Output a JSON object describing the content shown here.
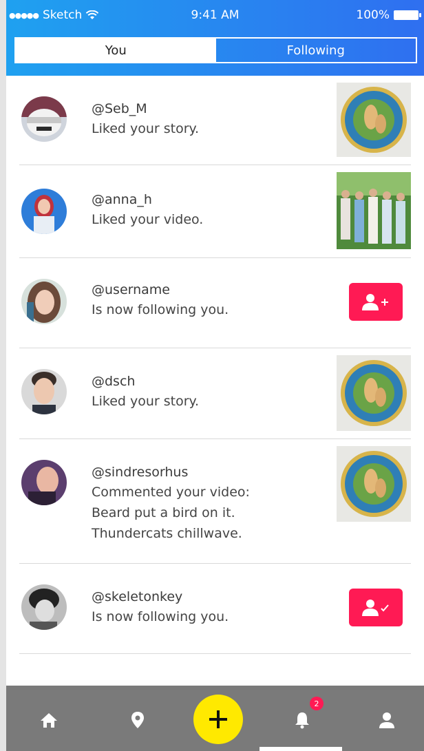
{
  "status": {
    "carrier": "Sketch",
    "time": "9:41 AM",
    "battery": "100%"
  },
  "tabs": {
    "you": "You",
    "following": "Following",
    "active": "you"
  },
  "notifications": [
    {
      "username": "@Seb_M",
      "message": "Liked your story.",
      "action": "thumbnail",
      "thumb": "plate"
    },
    {
      "username": "@anna_h",
      "message": "Liked your video.",
      "action": "thumbnail",
      "thumb": "group-photo"
    },
    {
      "username": "@username",
      "message": "Is now following you.",
      "action": "follow-back"
    },
    {
      "username": "@dsch",
      "message": "Liked your story.",
      "action": "thumbnail",
      "thumb": "plate"
    },
    {
      "username": "@sindresorhus",
      "message": "Commented your video:",
      "comment_line1": "Beard put a bird on it.",
      "comment_line2": "Thundercats chillwave.",
      "action": "thumbnail",
      "thumb": "plate"
    },
    {
      "username": "@skeletonkey",
      "message": "Is now following you.",
      "action": "following"
    }
  ],
  "tabbar": {
    "icons": [
      "home-icon",
      "location-pin-icon",
      "add-icon",
      "bell-icon",
      "profile-icon"
    ],
    "notification_badge": "2",
    "active": "bell-icon"
  },
  "colors": {
    "header_start": "#1fa1f0",
    "header_end": "#2f6ff0",
    "accent_red": "#ff1a54",
    "fab_yellow": "#ffe900",
    "tabbar_gray": "#7a7a7a"
  }
}
